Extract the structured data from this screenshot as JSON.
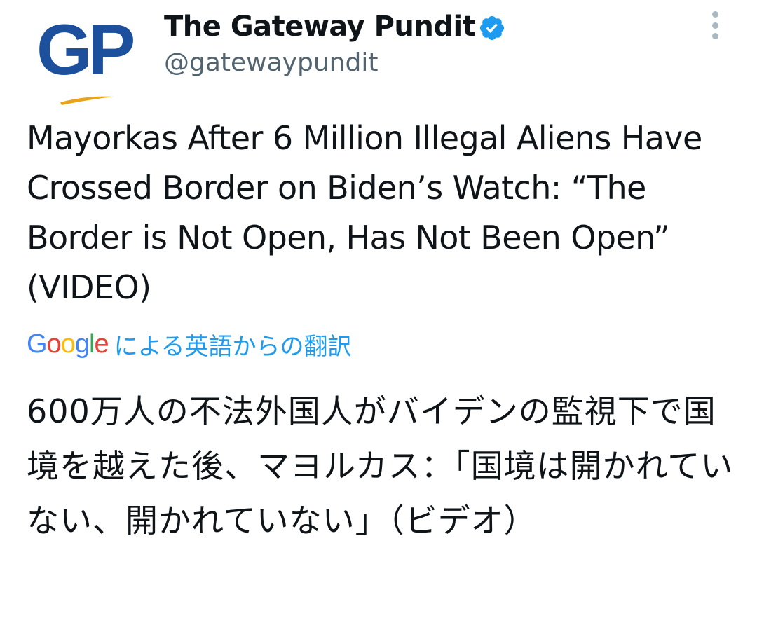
{
  "account": {
    "avatar_letters": "GP",
    "display_name": "The Gateway Pundit",
    "handle": "@gatewaypundit",
    "verified_icon": "verified-badge-icon",
    "avatar_color": "#1c4f9c",
    "swoosh_color": "#e8a317"
  },
  "more_menu": {
    "icon": "more-vertical-icon"
  },
  "tweet": {
    "text": "Mayorkas After 6 Million Illegal Aliens Have Crossed Border on Biden’s Watch: “The Border is Not Open, Has Not Been Open” (VIDEO)"
  },
  "translation": {
    "provider_logo": {
      "letters": [
        "G",
        "o",
        "o",
        "g",
        "l",
        "e"
      ],
      "colors": [
        "#4285f4",
        "#ea4335",
        "#fbbc05",
        "#4285f4",
        "#34a853",
        "#ea4335"
      ]
    },
    "label": "による英語からの翻訳",
    "label_color": "#1d9bf0",
    "text": "600万人の不法外国人がバイデンの監視下で国境を越えた後、マヨルカス：「国境は開かれていない、開かれていない」（ビデオ）"
  }
}
